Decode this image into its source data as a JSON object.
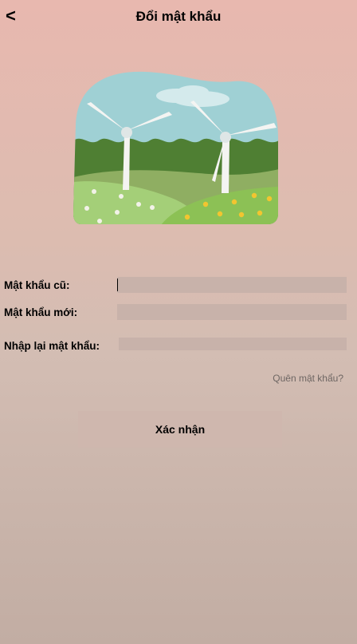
{
  "header": {
    "back_label": "<",
    "title": "Đổi mật khẩu"
  },
  "illustration": {
    "icon": "wind-turbine-landscape-illustration",
    "colors": {
      "sky": "#9fd0d4",
      "cloud": "#d4eaec",
      "forest": "#4f7f33",
      "hill_mid": "#8fae62",
      "hill_left": "#a4cf78",
      "hill_right": "#8cc155",
      "turbine": "#f4f4f2",
      "flower_yellow": "#f2c530",
      "flower_white": "#f2f2e8"
    }
  },
  "form": {
    "old_password": {
      "label": "Mật khẩu cũ:",
      "value": ""
    },
    "new_password": {
      "label": "Mật khẩu mới:",
      "value": ""
    },
    "confirm_password": {
      "label": "Nhập lại mật khẩu:",
      "value": ""
    }
  },
  "forgot_password": "Quên mật khẩu?",
  "confirm_button": "Xác nhận",
  "colors": {
    "background_top": "#e8b8af",
    "background_bottom": "#c2ada3",
    "input_fill": "#c8b2aa",
    "button_fill": "#cfb7ae",
    "link_text": "#6e6663"
  }
}
